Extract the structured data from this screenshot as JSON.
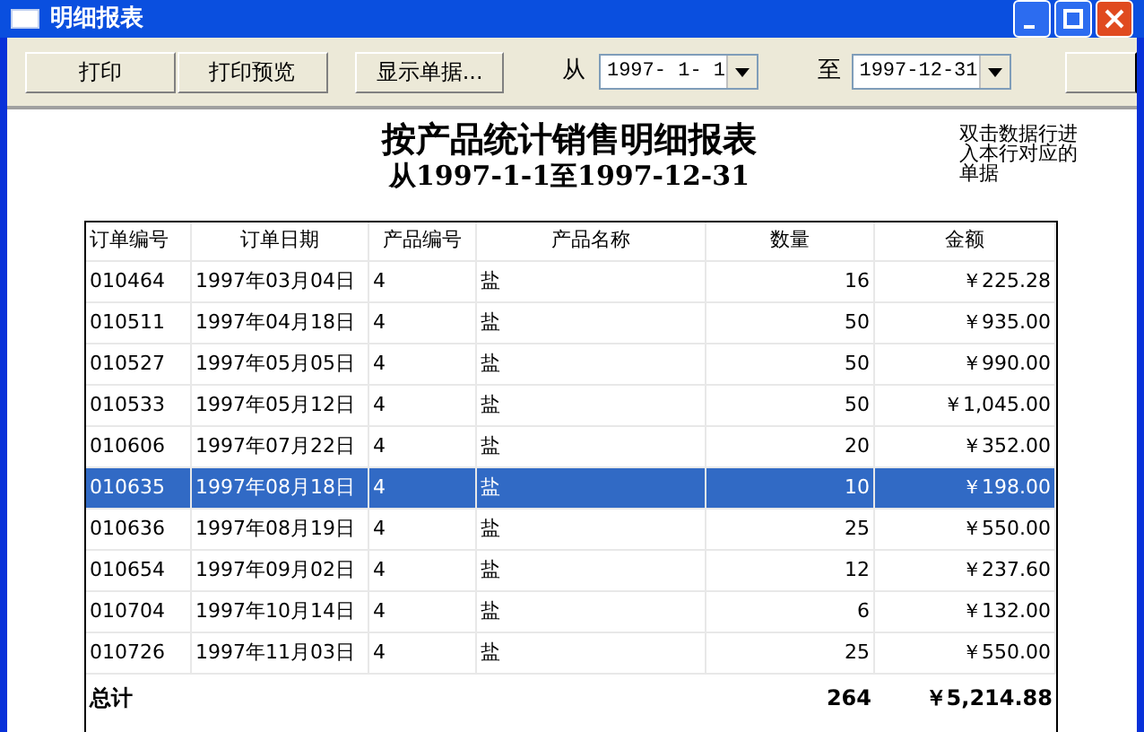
{
  "window": {
    "title": "明细报表"
  },
  "toolbar": {
    "buttons": [
      "打印",
      "打印预览",
      "显示单据..."
    ],
    "from_label": "从",
    "from_value": "1997- 1- 1",
    "to_label": "至",
    "to_value": "1997-12-31"
  },
  "report": {
    "title": "按产品统计销售明细报表",
    "subtitle": "从1997-1-1至1997-12-31",
    "hint": "双击数据行进入本行对应的单据"
  },
  "table": {
    "columns": [
      "订单编号",
      "订单日期",
      "产品编号",
      "产品名称",
      "数量",
      "金额"
    ],
    "rows": [
      {
        "cells": [
          "010464",
          "1997年03月04日",
          "4",
          "盐",
          "16",
          "￥225.28"
        ],
        "selected": false
      },
      {
        "cells": [
          "010511",
          "1997年04月18日",
          "4",
          "盐",
          "50",
          "￥935.00"
        ],
        "selected": false
      },
      {
        "cells": [
          "010527",
          "1997年05月05日",
          "4",
          "盐",
          "50",
          "￥990.00"
        ],
        "selected": false
      },
      {
        "cells": [
          "010533",
          "1997年05月12日",
          "4",
          "盐",
          "50",
          "￥1,045.00"
        ],
        "selected": false
      },
      {
        "cells": [
          "010606",
          "1997年07月22日",
          "4",
          "盐",
          "20",
          "￥352.00"
        ],
        "selected": false
      },
      {
        "cells": [
          "010635",
          "1997年08月18日",
          "4",
          "盐",
          "10",
          "￥198.00"
        ],
        "selected": true
      },
      {
        "cells": [
          "010636",
          "1997年08月19日",
          "4",
          "盐",
          "25",
          "￥550.00"
        ],
        "selected": false
      },
      {
        "cells": [
          "010654",
          "1997年09月02日",
          "4",
          "盐",
          "12",
          "￥237.60"
        ],
        "selected": false
      },
      {
        "cells": [
          "010704",
          "1997年10月14日",
          "4",
          "盐",
          "6",
          "￥132.00"
        ],
        "selected": false
      },
      {
        "cells": [
          "010726",
          "1997年11月03日",
          "4",
          "盐",
          "25",
          "￥550.00"
        ],
        "selected": false
      }
    ],
    "total": {
      "label": "总计",
      "quantity": "264",
      "amount": "￥5,214.88"
    }
  }
}
